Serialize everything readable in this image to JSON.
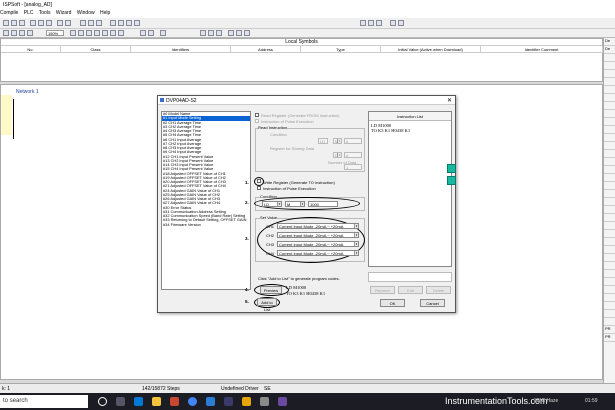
{
  "window": {
    "title": "ISPSoft - [analog_AD]"
  },
  "menu": [
    "Compile",
    "PLC",
    "Tools",
    "Wizard",
    "Window",
    "Help"
  ],
  "toolbar": {
    "zoom": "150%"
  },
  "local_symbols": {
    "title": "Local Symbols",
    "columns": [
      "No.",
      "Class",
      "Identifiers",
      "Address",
      "Type",
      "Initial Value (Active when Download)",
      "Identifier Comment"
    ]
  },
  "right_panel": {
    "items": [
      "De",
      "De",
      "",
      "",
      "",
      "",
      "",
      "",
      "",
      "",
      "",
      "",
      "",
      "",
      "",
      "",
      "",
      "",
      "",
      "",
      "",
      "",
      "",
      "",
      "",
      "",
      "",
      "",
      "",
      "",
      "",
      "",
      "",
      "",
      "",
      "",
      "PR",
      "PR"
    ]
  },
  "ladder": {
    "network_label": "Network 1"
  },
  "dialog": {
    "title": "DVP04AD-S2",
    "functions": [
      "#0 Model Name",
      "#1 Input Mode Setting",
      "#2 CH1 Average Time",
      "#3 CH2 Average Time",
      "#4 CH3 Average Time",
      "#5 CH4 Average Time",
      "#6 CH1 Input Average",
      "#7 CH2 Input Average",
      "#8 CH3 Input Average",
      "#9 CH4 Input Average",
      "#12 CH1 Input Present Value",
      "#13 CH2 Input Present Value",
      "#14 CH3 Input Present Value",
      "#15 CH4 Input Present Value",
      "#18 Adjusted OFFSET Value of CH1",
      "#19 Adjusted OFFSET Value of CH2",
      "#20 Adjusted OFFSET Value of CH3",
      "#21 Adjusted OFFSET Value of CH4",
      "#24 Adjusted GAIN Value of CH1",
      "#25 Adjusted GAIN Value of CH2",
      "#26 Adjusted GAIN Value of CH3",
      "#27 Adjusted GAIN Value of CH4",
      "#30 Error Status",
      "#31 Communication Address Setting",
      "#32 Communication Speed (Band Rate) Setting",
      "#33 Returning to Default Setting, OFFSET GAIN",
      "#34 Firmware Version"
    ],
    "read_register_label": "Read Register (Generate FROM Instruction)",
    "read_pulse_label": "Instruction of Pulse Execution",
    "read_instruction_label": "Read Instruction",
    "read_condition_label": "Condition",
    "read_cond_device": "LD",
    "read_cond_type": "M",
    "read_cond_num": "0",
    "read_register_store_label": "Register for Storing Data",
    "read_store_type": "D",
    "read_store_num": "0",
    "read_number_label": "Number of Data",
    "read_number": "1",
    "write_register_label": "Write Register (Generate TO Instruction)",
    "write_pulse_label": "Instruction of Pulse Execution",
    "write_condition_label": "Condition",
    "write_cond_device": "LD",
    "write_cond_type": "M",
    "write_cond_num": "1000",
    "set_value_label": "Set Value",
    "channels": [
      {
        "name": "CH1",
        "mode": "Current Input Mode -20mA ~ +20mA"
      },
      {
        "name": "CH2",
        "mode": "Current Input Mode -20mA ~ +20mA"
      },
      {
        "name": "CH3",
        "mode": "Current Input Mode -20mA ~ +20mA"
      },
      {
        "name": "CH4",
        "mode": "Current Input Mode -20mA ~ +20mA"
      }
    ],
    "hint": "Click \"Add to List\" to generate program codes.",
    "preview_label": "Preview",
    "add_label": "Add to List",
    "preview_code": [
      "LD M1000",
      "TO K3 K1 H0438 K1"
    ],
    "instruction_list_title": "Instruction List",
    "instruction_list": [
      "LD M1000",
      "TO K3 K1 H0438 K1"
    ],
    "replace_label": "Replace",
    "edit_label": "Edit",
    "delete_label": "Delete",
    "ok_label": "OK",
    "cancel_label": "Cancel",
    "steps": [
      "1.",
      "2.",
      "3.",
      "4.",
      "5."
    ]
  },
  "statusbar": {
    "left": "k: 1",
    "steps": "142/15872 Steps",
    "driver": "Undefined Driver",
    "mode": "SE"
  },
  "taskbar": {
    "search_placeholder": "to search",
    "brand": "InstrumentationTools.com",
    "weather": "30°C  Haze",
    "clock": "01:59"
  }
}
